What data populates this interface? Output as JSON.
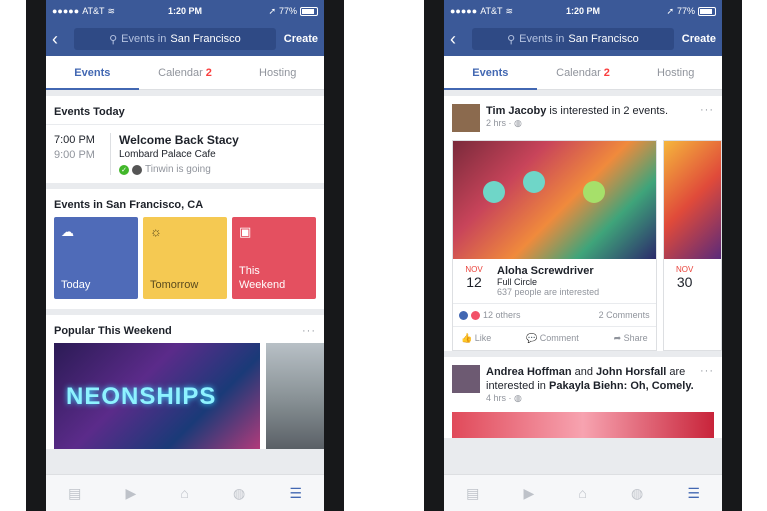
{
  "status": {
    "carrier": "AT&T",
    "time": "1:20 PM",
    "battery": "77%"
  },
  "nav": {
    "back": "‹",
    "search_prefix": "Events in",
    "search_city": "San Francisco",
    "create": "Create"
  },
  "tabs": {
    "events": "Events",
    "calendar": "Calendar",
    "calendar_badge": "2",
    "hosting": "Hosting"
  },
  "left": {
    "today_title": "Events Today",
    "event": {
      "start": "7:00 PM",
      "end": "9:00 PM",
      "name": "Welcome Back Stacy",
      "place": "Lombard Palace Cafe",
      "going": "Tinwin is going"
    },
    "city_title": "Events in San Francisco, CA",
    "tiles": [
      {
        "label": "Today"
      },
      {
        "label": "Tomorrow"
      },
      {
        "label1": "This",
        "label2": "Weekend"
      }
    ],
    "popular_title": "Popular This Weekend",
    "popular_more": "···",
    "photo_text": "NEONSHIPS"
  },
  "right": {
    "post1": {
      "user": "Tim Jacoby",
      "text": "is interested in 2 events.",
      "time": "2 hrs"
    },
    "event1": {
      "month": "NOV",
      "day": "12",
      "title": "Aloha Screwdriver",
      "host": "Full Circle",
      "interest": "637 people are interested"
    },
    "event2": {
      "month": "NOV",
      "day": "30"
    },
    "reacts": {
      "others": "12 others",
      "comments": "2 Comments"
    },
    "actions": {
      "like": "Like",
      "comment": "Comment",
      "share": "Share"
    },
    "post2": {
      "user1": "Andrea Hoffman",
      "and": "and",
      "user2": "John Horsfall",
      "text1": "are interested in",
      "event": "Pakayla Biehn: Oh, Comely.",
      "time": "4 hrs"
    }
  },
  "colors": {
    "brand": "#3b5998",
    "accent": "#4267b2",
    "badge": "#fa3e3e"
  }
}
